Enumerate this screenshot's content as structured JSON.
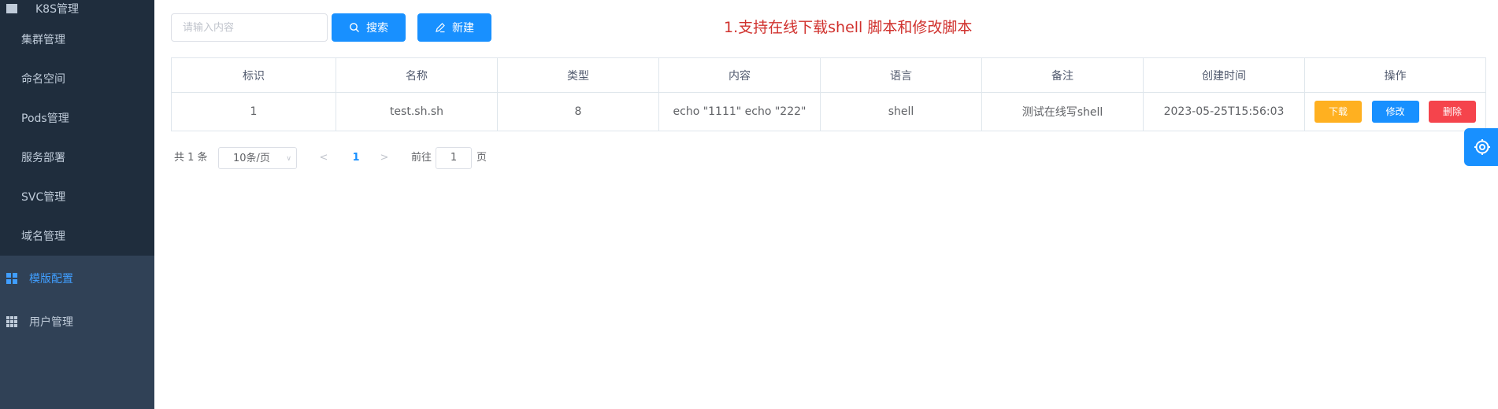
{
  "sidebar": {
    "clipped_title": "K8S管理",
    "sub_items": [
      {
        "label": "集群管理"
      },
      {
        "label": "命名空间"
      },
      {
        "label": "Pods管理"
      },
      {
        "label": "服务部署"
      },
      {
        "label": "SVC管理"
      },
      {
        "label": "域名管理"
      }
    ],
    "top_items": [
      {
        "label": "模版配置",
        "icon": "grid-icon",
        "active": true
      },
      {
        "label": "用户管理",
        "icon": "table-icon",
        "active": false
      }
    ],
    "active_color": "#409eff"
  },
  "toolbar": {
    "search_placeholder": "请输入内容",
    "search_label": "搜索",
    "new_label": "新建"
  },
  "notice": "1.支持在线下载shell 脚本和修改脚本",
  "table": {
    "headers": [
      "标识",
      "名称",
      "类型",
      "内容",
      "语言",
      "备注",
      "创建时间",
      "操作"
    ],
    "rows": [
      {
        "id": "1",
        "name": "test.sh.sh",
        "type": "8",
        "content": "echo \"1111\" echo \"222\"",
        "language": "shell",
        "remark": "测试在线写shell",
        "created": "2023-05-25T15:56:03",
        "actions": {
          "download": "下载",
          "edit": "修改",
          "delete": "删除"
        }
      }
    ]
  },
  "pagination": {
    "total_text": "共 1 条",
    "page_size": "10条/页",
    "current_page": "1",
    "goto_label": "前往",
    "goto_value": "1",
    "page_suffix": "页"
  },
  "colors": {
    "sidebar_bg": "#304156",
    "submenu_bg": "#1f2d3d",
    "primary": "#1890ff",
    "warning": "#ffb020",
    "danger": "#f5444c",
    "notice": "#d0312d"
  }
}
